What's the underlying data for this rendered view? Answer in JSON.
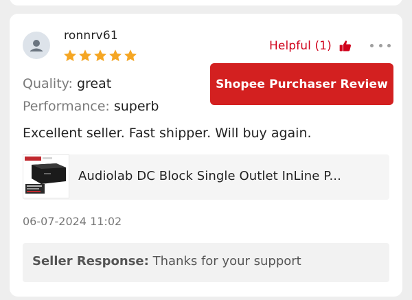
{
  "review": {
    "username": "ronnrv61",
    "rating": 5,
    "helpful_label": "Helpful (1)",
    "badge": "Shopee Purchaser Review",
    "quality_label": "Quality:",
    "quality_value": "great",
    "performance_label": "Performance:",
    "performance_value": "superb",
    "comment": "Excellent seller. Fast shipper. Will buy again.",
    "product_name": "Audiolab DC Block Single Outlet InLine P...",
    "timestamp": "06-07-2024 11:02"
  },
  "seller_response": {
    "label": "Seller Response:",
    "text": "Thanks for your support"
  },
  "colors": {
    "accent_red": "#d32020",
    "star_gold": "#f5a623",
    "helpful_red": "#d0021b"
  },
  "icons": {
    "avatar": "user-avatar-icon",
    "star": "star-icon",
    "thumb": "thumbs-up-icon",
    "more": "more-horizontal-icon"
  }
}
